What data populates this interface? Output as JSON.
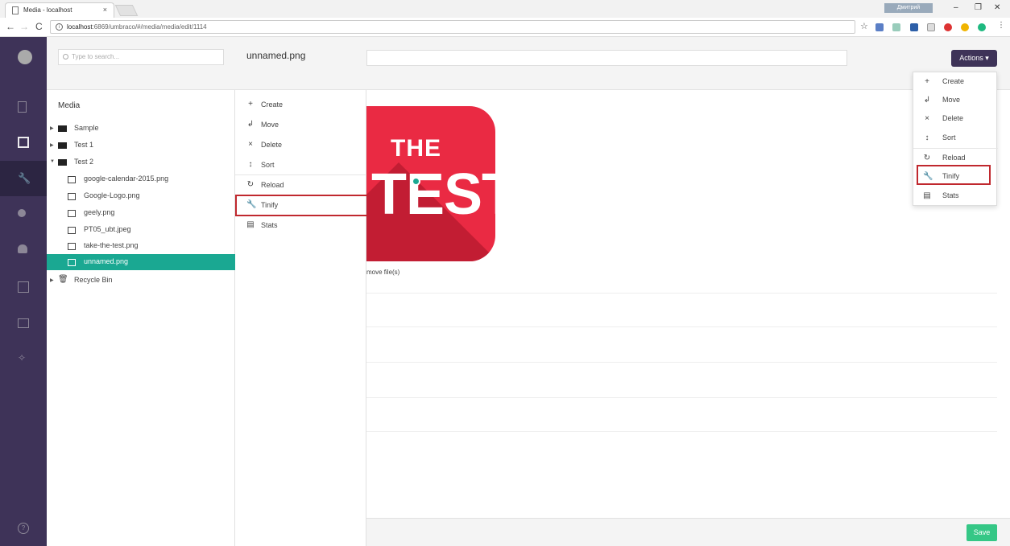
{
  "browser": {
    "tab_title": "Media - localhost",
    "url_host": "localhost",
    "url_rest": ":6869/umbraco/#/media/media/edit/1114",
    "window_badge": "Дмитрий"
  },
  "search": {
    "placeholder": "Type to search..."
  },
  "tree": {
    "root_label": "Media",
    "nodes": [
      {
        "label": "Sample",
        "type": "folder"
      },
      {
        "label": "Test 1",
        "type": "folder"
      },
      {
        "label": "Test 2",
        "type": "folder"
      },
      {
        "label": "google-calendar-2015.png",
        "type": "image"
      },
      {
        "label": "Google-Logo.png",
        "type": "image"
      },
      {
        "label": "geely.png",
        "type": "image"
      },
      {
        "label": "PT05_ubt.jpeg",
        "type": "image"
      },
      {
        "label": "take-the-test.png",
        "type": "image"
      },
      {
        "label": "unnamed.png",
        "type": "image",
        "selected": true
      },
      {
        "label": "Recycle Bin",
        "type": "bin"
      }
    ]
  },
  "context_menu": {
    "title": "unnamed.png",
    "items": [
      {
        "label": "Create",
        "icon": "plus-icon"
      },
      {
        "label": "Move",
        "icon": "move-icon"
      },
      {
        "label": "Delete",
        "icon": "delete-icon"
      },
      {
        "label": "Sort",
        "icon": "sort-icon"
      },
      {
        "label": "Reload",
        "icon": "reload-icon"
      },
      {
        "label": "Tinify",
        "icon": "wrench-icon",
        "highlighted": true
      },
      {
        "label": "Stats",
        "icon": "stats-icon"
      }
    ]
  },
  "main": {
    "actions_label": "Actions",
    "preview_the": "THE",
    "preview_test": "TEST",
    "remove_text": "move file(s)",
    "save_label": "Save"
  },
  "actions_dropdown": {
    "items": [
      {
        "label": "Create",
        "icon": "plus-icon"
      },
      {
        "label": "Move",
        "icon": "move-icon"
      },
      {
        "label": "Delete",
        "icon": "delete-icon"
      },
      {
        "label": "Sort",
        "icon": "sort-icon"
      },
      {
        "label": "Reload",
        "icon": "reload-icon"
      },
      {
        "label": "Tinify",
        "icon": "wrench-icon",
        "highlighted": true
      },
      {
        "label": "Stats",
        "icon": "stats-icon"
      }
    ]
  },
  "colors": {
    "sidebar": "#3e3358",
    "selection": "#1aa892",
    "highlight_border": "#c0282e",
    "save": "#35c786",
    "preview_red": "#ea2a43"
  }
}
